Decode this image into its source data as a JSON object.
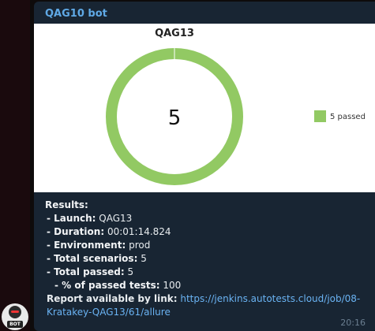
{
  "message": {
    "sender": "QAG10 bot",
    "time": "20:16",
    "avatar_label": "BOT"
  },
  "chart_data": {
    "type": "pie",
    "title": "QAG13",
    "center_label": "5",
    "slices": [
      {
        "name": "5 passed",
        "value": 5,
        "color": "#92c963"
      }
    ],
    "legend_position": "right"
  },
  "results": {
    "heading": "Results:",
    "launch_label": "- Launch:",
    "launch_value": "QAG13",
    "duration_label": "- Duration:",
    "duration_value": "00:01:14.824",
    "environment_label": "- Environment:",
    "environment_value": "prod",
    "total_scenarios_label": "- Total scenarios:",
    "total_scenarios_value": "5",
    "total_passed_label": "- Total passed:",
    "total_passed_value": "5",
    "percent_passed_label": "- % of passed tests:",
    "percent_passed_value": "100",
    "report_label": "Report available by link:",
    "report_link": "https://jenkins.autotests.cloud/job/08-Kratakey-QAG13/61/allure"
  },
  "colors": {
    "bubble": "#182533",
    "sender": "#5fa9e6",
    "link": "#6ab3f3",
    "passed": "#92c963"
  }
}
